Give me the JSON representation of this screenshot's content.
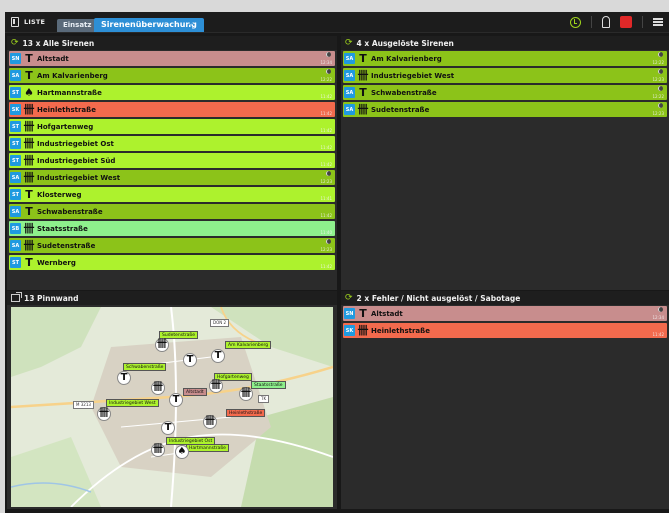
{
  "topbar": {
    "list_label": "LISTE",
    "tab_einsatz": "Einsatz",
    "tab_sirens": "Sirenenüberwachung",
    "icons": [
      "list-icon",
      "tools-icon",
      "clock-icon",
      "siren-icon",
      "alarm-icon",
      "menu-icon"
    ]
  },
  "colors": {
    "green": "#adf22d",
    "olive": "#8cc319",
    "pink": "#c88d8d",
    "red": "#f36a4d",
    "mint": "#8ef08c",
    "badge": "#1f9ae0",
    "accent": "#2d8fd6"
  },
  "panel_all": {
    "title": "13 x Alle Sirenen",
    "rows": [
      {
        "badge": "SN",
        "icon": "siren-single-icon",
        "name": "Altstadt",
        "time": "12:34",
        "color": "#c88d8d",
        "moon": true
      },
      {
        "badge": "SA",
        "icon": "siren-single-icon",
        "name": "Am Kalvarienberg",
        "time": "12:22",
        "color": "#8cc319",
        "moon": true
      },
      {
        "badge": "ST",
        "icon": "siren-filled-icon",
        "name": "Hartmannstraße",
        "time": "11:42",
        "color": "#adf22d",
        "moon": false
      },
      {
        "badge": "SK",
        "icon": "siren-multi-icon",
        "name": "Heinlethstraße",
        "time": "11:42",
        "color": "#f36a4d",
        "moon": false
      },
      {
        "badge": "ST",
        "icon": "siren-multi-icon",
        "name": "Hofgartenweg",
        "time": "11:42",
        "color": "#adf22d",
        "moon": false
      },
      {
        "badge": "ST",
        "icon": "siren-multi-icon",
        "name": "Industriegebiet Ost",
        "time": "11:42",
        "color": "#adf22d",
        "moon": false
      },
      {
        "badge": "ST",
        "icon": "siren-multi-icon",
        "name": "Industriegebiet Süd",
        "time": "11:42",
        "color": "#adf22d",
        "moon": false
      },
      {
        "badge": "SA",
        "icon": "siren-multi-icon",
        "name": "Industriegebiet West",
        "time": "12:23",
        "color": "#8cc319",
        "moon": true
      },
      {
        "badge": "ST",
        "icon": "siren-single-icon",
        "name": "Klosterweg",
        "time": "11:41",
        "color": "#adf22d",
        "moon": false
      },
      {
        "badge": "SA",
        "icon": "siren-single-icon",
        "name": "Schwabenstraße",
        "time": "11:42",
        "color": "#8cc319",
        "moon": false
      },
      {
        "badge": "SB",
        "icon": "siren-multi-icon",
        "name": "Staatsstraße",
        "time": "11:40",
        "color": "#8ef08c",
        "moon": false
      },
      {
        "badge": "SA",
        "icon": "siren-multi-icon",
        "name": "Sudetenstraße",
        "time": "12:23",
        "color": "#8cc319",
        "moon": true
      },
      {
        "badge": "ST",
        "icon": "siren-single-icon",
        "name": "Wernberg",
        "time": "11:42",
        "color": "#adf22d",
        "moon": false
      }
    ]
  },
  "panel_triggered": {
    "title": "4 x Ausgelöste Sirenen",
    "rows": [
      {
        "badge": "SA",
        "icon": "siren-single-icon",
        "name": "Am Kalvarienberg",
        "time": "12:22",
        "color": "#8cc319",
        "moon": true
      },
      {
        "badge": "SA",
        "icon": "siren-multi-icon",
        "name": "Industriegebiet West",
        "time": "12:23",
        "color": "#8cc319",
        "moon": true
      },
      {
        "badge": "SA",
        "icon": "siren-single-icon",
        "name": "Schwabenstraße",
        "time": "12:22",
        "color": "#8cc319",
        "moon": true
      },
      {
        "badge": "SA",
        "icon": "siren-multi-icon",
        "name": "Sudetenstraße",
        "time": "12:23",
        "color": "#8cc319",
        "moon": true
      }
    ]
  },
  "panel_board": {
    "title": "13 Pinnwand",
    "map_labels": [
      {
        "text": "Sudetenstraße",
        "color": "#adf22d"
      },
      {
        "text": "Am Kalvarienberg",
        "color": "#adf22d"
      },
      {
        "text": "Schwabenstraße",
        "color": "#adf22d"
      },
      {
        "text": "Hofgartenweg",
        "color": "#adf22d"
      },
      {
        "text": "Staatsstraße",
        "color": "#8ef08c"
      },
      {
        "text": "Altstadt",
        "color": "#c88d8d"
      },
      {
        "text": "Industriegebiet West",
        "color": "#adf22d"
      },
      {
        "text": "Heinlethstraße",
        "color": "#f36a4d"
      },
      {
        "text": "Industriegebiet Ost",
        "color": "#adf22d"
      },
      {
        "text": "Hartmannstraße",
        "color": "#adf22d"
      }
    ],
    "road_labels": [
      "DON 2",
      "M 3213",
      "TK"
    ]
  },
  "panel_errors": {
    "title": "2 x Fehler / Nicht ausgelöst / Sabotage",
    "rows": [
      {
        "badge": "SN",
        "icon": "siren-single-icon",
        "name": "Altstadt",
        "time": "12:34",
        "color": "#c88d8d",
        "moon": true
      },
      {
        "badge": "SK",
        "icon": "siren-multi-icon",
        "name": "Heinlethstraße",
        "time": "11:42",
        "color": "#f36a4d",
        "moon": false
      }
    ]
  }
}
